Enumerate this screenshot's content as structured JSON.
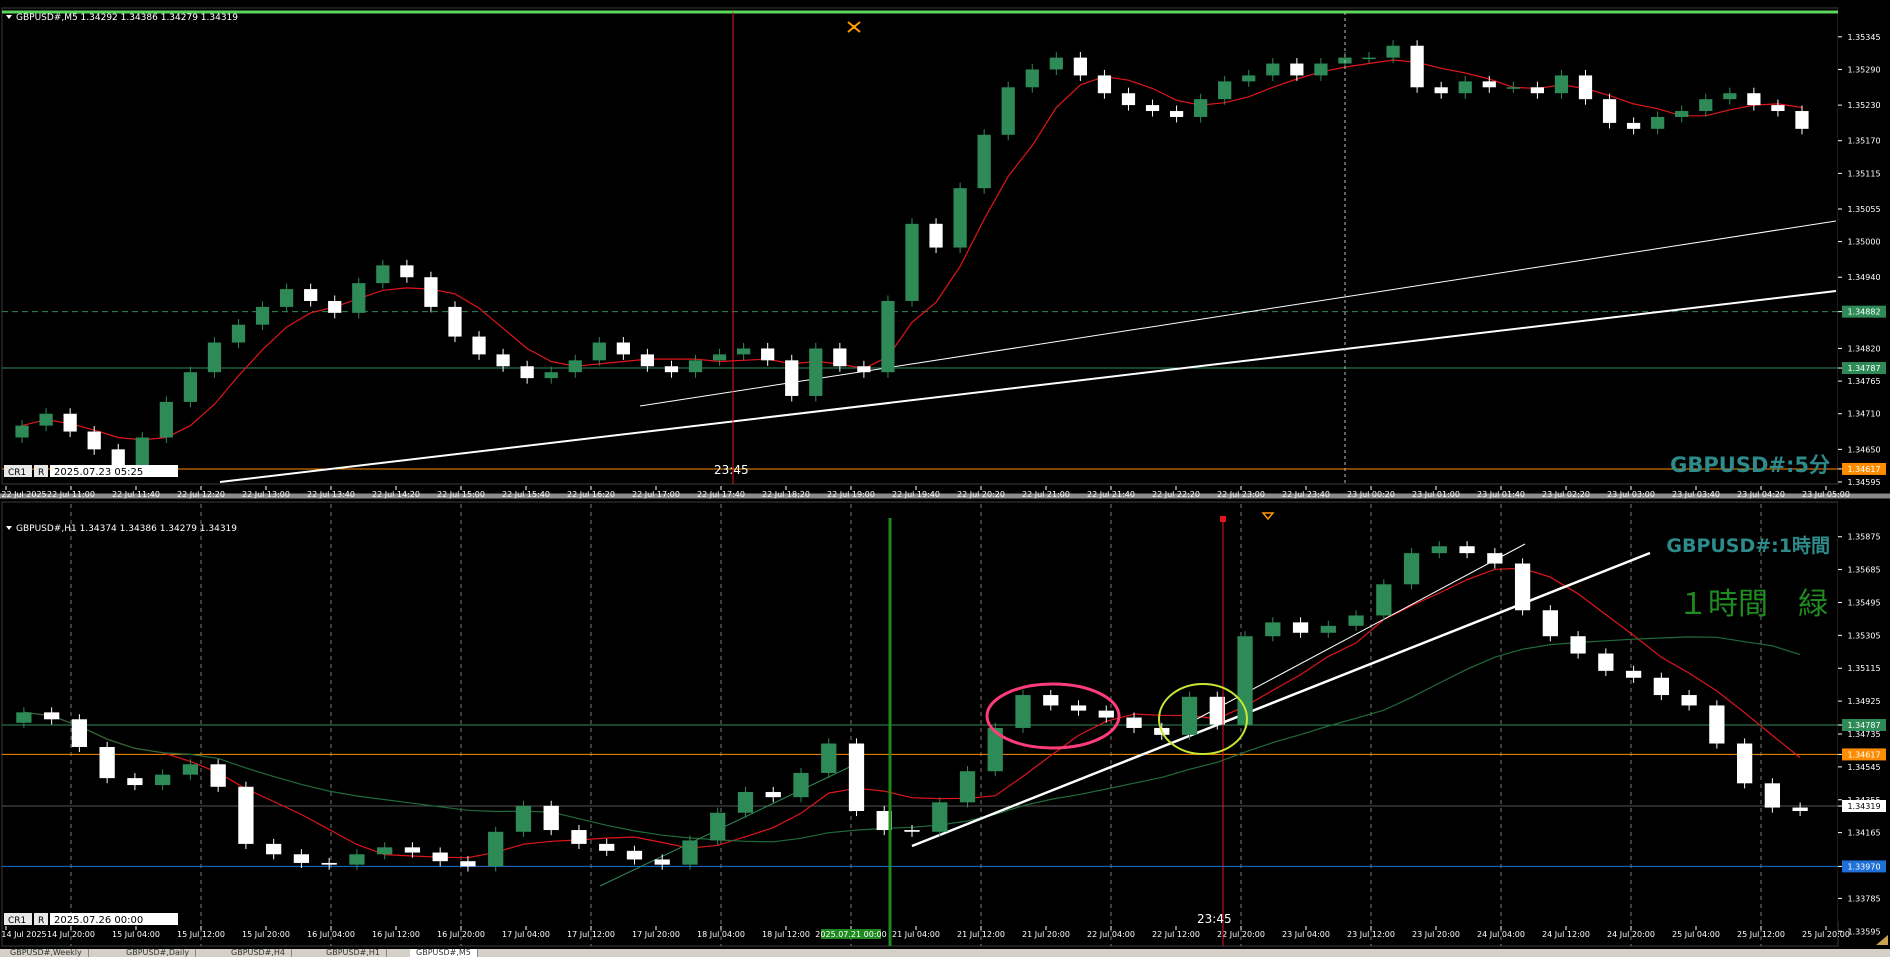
{
  "colors": {
    "background": "#000000",
    "bull": "#2e8b57",
    "bull_bright": "#cfe8cf",
    "bear": "#ffffff",
    "ma_red": "#e0161b",
    "ma_green": "#1f6b3a",
    "grid": "#7a7a7a",
    "axis_text": "#ffffff",
    "label_teal": "#2e8b8b",
    "label_green": "#1e8c1e",
    "orange_line": "#ff8c00",
    "blue_line": "#1e6fd6",
    "green_line": "#1f8a1f",
    "red_vline": "#e0161b",
    "ellipse_pink": "#ff3c7a",
    "ellipse_yellow": "#c8e632",
    "border_green": "#5cd65c"
  },
  "panes": [
    {
      "header": "GBPUSD#,M5  1.34292 1.34386 1.34279 1.34319",
      "watermark": "GBPUSD#:5分",
      "corner_date": "2025.07.23 05:25",
      "vline_label": "23:45",
      "cr_label": "CR1",
      "r_label": "R",
      "price_levels": [
        {
          "value": 1.35345,
          "label": "1.35345"
        },
        {
          "value": 1.3529,
          "label": "1.35290"
        },
        {
          "value": 1.3523,
          "label": "1.35230"
        },
        {
          "value": 1.3517,
          "label": "1.35170"
        },
        {
          "value": 1.35115,
          "label": "1.35115"
        },
        {
          "value": 1.35055,
          "label": "1.35055"
        },
        {
          "value": 1.35,
          "label": "1.35000"
        },
        {
          "value": 1.3494,
          "label": "1.34940"
        },
        {
          "value": 1.34882,
          "label": "1.34882",
          "tag": "#2e8b57"
        },
        {
          "value": 1.3482,
          "label": "1.34820"
        },
        {
          "value": 1.34787,
          "label": "1.34787",
          "tag": "#2e8b57"
        },
        {
          "value": 1.34765,
          "label": "1.34765"
        },
        {
          "value": 1.3471,
          "label": "1.34710"
        },
        {
          "value": 1.3465,
          "label": "1.34650"
        },
        {
          "value": 1.34617,
          "label": "1.34617",
          "tag": "#ff8c00"
        },
        {
          "value": 1.34595,
          "label": "1.34595"
        }
      ],
      "time_labels": [
        "22 Jul 2025",
        "22 Jul 11:00",
        "22 Jul 11:40",
        "22 Jul 12:20",
        "22 Jul 13:00",
        "22 Jul 13:40",
        "22 Jul 14:20",
        "22 Jul 15:00",
        "22 Jul 15:40",
        "22 Jul 16:20",
        "22 Jul 17:00",
        "22 Jul 17:40",
        "22 Jul 18:20",
        "22 Jul 19:00",
        "22 Jul 19:40",
        "22 Jul 20:20",
        "22 Jul 21:00",
        "22 Jul 21:40",
        "22 Jul 22:20",
        "22 Jul 23:00",
        "22 Jul 23:40",
        "23 Jul 00:20",
        "23 Jul 01:00",
        "23 Jul 01:40",
        "23 Jul 02:20",
        "23 Jul 03:00",
        "23 Jul 03:40",
        "23 Jul 04:20",
        "23 Jul 05:00"
      ]
    },
    {
      "header": "GBPUSD#,H1  1.34374 1.34386 1.34279 1.34319",
      "watermark": "GBPUSD#:1時間",
      "note": "１時間　緑",
      "corner_date": "2025.07.26 00:00",
      "vline_label": "23:45",
      "green_vline_label": "2025.07.21 00:00",
      "cr_label": "CR1",
      "r_label": "R",
      "price_levels": [
        {
          "value": 1.35875,
          "label": "1.35875"
        },
        {
          "value": 1.35685,
          "label": "1.35685"
        },
        {
          "value": 1.35495,
          "label": "1.35495"
        },
        {
          "value": 1.35305,
          "label": "1.35305"
        },
        {
          "value": 1.35115,
          "label": "1.35115"
        },
        {
          "value": 1.34925,
          "label": "1.34925"
        },
        {
          "value": 1.34787,
          "label": "1.34787",
          "tag": "#2e8b57"
        },
        {
          "value": 1.34735,
          "label": "1.34735"
        },
        {
          "value": 1.34617,
          "label": "1.34617",
          "tag": "#ff8c00"
        },
        {
          "value": 1.34545,
          "label": "1.34545"
        },
        {
          "value": 1.34355,
          "label": "1.34355"
        },
        {
          "value": 1.34319,
          "label": "1.34319",
          "tag": "#ffffff"
        },
        {
          "value": 1.34165,
          "label": "1.34165"
        },
        {
          "value": 1.3397,
          "label": "1.33970",
          "tag": "#1e6fd6"
        },
        {
          "value": 1.33785,
          "label": "1.33785"
        },
        {
          "value": 1.33595,
          "label": "1.33595"
        }
      ],
      "time_labels": [
        "14 Jul 2025",
        "14 Jul 20:00",
        "15 Jul 04:00",
        "15 Jul 12:00",
        "15 Jul 20:00",
        "16 Jul 04:00",
        "16 Jul 12:00",
        "16 Jul 20:00",
        "17 Jul 04:00",
        "17 Jul 12:00",
        "17 Jul 20:00",
        "18 Jul 04:00",
        "18 Jul 12:00",
        "2025.07.21 00:00",
        "21 Jul 04:00",
        "21 Jul 12:00",
        "21 Jul 20:00",
        "22 Jul 04:00",
        "22 Jul 12:00",
        "22 Jul 20:00",
        "23 Jul 04:00",
        "23 Jul 12:00",
        "23 Jul 20:00",
        "24 Jul 04:00",
        "24 Jul 12:00",
        "24 Jul 20:00",
        "25 Jul 04:00",
        "25 Jul 12:00",
        "25 Jul 20:00"
      ]
    }
  ],
  "tabs": [
    "GBPUSD#,Weekly",
    "GBPUSD#,Daily",
    "GBPUSD#,H4",
    "GBPUSD#,H1",
    "GBPUSD#,M5"
  ],
  "chart_data": [
    {
      "type": "candlestick",
      "title": "GBPUSD#,M5",
      "ylim": [
        1.34595,
        1.3537
      ],
      "series": [
        {
          "name": "GBPUSD#,M5",
          "close": [
            1.3469,
            1.3471,
            1.3468,
            1.3465,
            1.3462,
            1.3467,
            1.3473,
            1.3478,
            1.3483,
            1.3486,
            1.3489,
            1.3492,
            1.349,
            1.3488,
            1.3493,
            1.3496,
            1.3494,
            1.3489,
            1.3484,
            1.3481,
            1.3479,
            1.3477,
            1.3478,
            1.348,
            1.3483,
            1.3481,
            1.3479,
            1.3478,
            1.348,
            1.3481,
            1.3482,
            1.348,
            1.3474,
            1.3482,
            1.3479,
            1.3478,
            1.349,
            1.3503,
            1.3499,
            1.3509,
            1.3518,
            1.3526,
            1.3529,
            1.3531,
            1.3528,
            1.3525,
            1.3523,
            1.3522,
            1.3521,
            1.3524,
            1.3527,
            1.3528,
            1.353,
            1.3528,
            1.353,
            1.3531,
            1.3531,
            1.3533,
            1.3526,
            1.3525,
            1.3527,
            1.3526,
            1.3526,
            1.3525,
            1.3528,
            1.3524,
            1.352,
            1.3519,
            1.3521,
            1.3522,
            1.3524,
            1.3525,
            1.3523,
            1.3522,
            1.3519
          ]
        }
      ]
    },
    {
      "type": "candlestick",
      "title": "GBPUSD#,H1",
      "ylim": [
        1.3351,
        1.3596
      ],
      "series": [
        {
          "name": "GBPUSD#,H1",
          "close": [
            1.3486,
            1.3482,
            1.3466,
            1.3448,
            1.3444,
            1.345,
            1.3456,
            1.3443,
            1.341,
            1.3404,
            1.3399,
            1.3398,
            1.3404,
            1.3408,
            1.3405,
            1.34,
            1.3397,
            1.3417,
            1.3432,
            1.3418,
            1.341,
            1.3406,
            1.3401,
            1.3398,
            1.3412,
            1.3428,
            1.344,
            1.3437,
            1.3451,
            1.3468,
            1.3429,
            1.3418,
            1.3417,
            1.3434,
            1.3452,
            1.3477,
            1.3496,
            1.349,
            1.3487,
            1.3483,
            1.3477,
            1.3473,
            1.3495,
            1.3479,
            1.353,
            1.3538,
            1.3532,
            1.3536,
            1.3542,
            1.356,
            1.3578,
            1.3582,
            1.3578,
            1.3572,
            1.3545,
            1.353,
            1.352,
            1.351,
            1.3506,
            1.3496,
            1.349,
            1.3468,
            1.3445,
            1.3431,
            1.3429
          ]
        }
      ]
    }
  ]
}
